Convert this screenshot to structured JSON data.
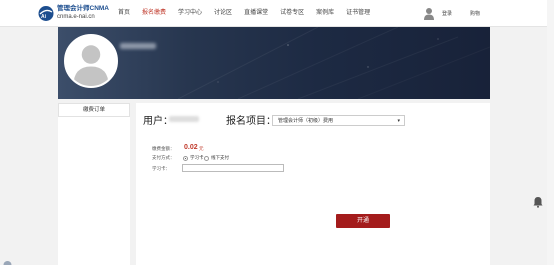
{
  "header": {
    "brand_name": "管理会计师CNMA",
    "brand_url": "cnma.e-nai.cn",
    "nav": [
      {
        "label": "首页",
        "active": false
      },
      {
        "label": "报名缴费",
        "active": true
      },
      {
        "label": "学习中心",
        "active": false
      },
      {
        "label": "讨论区",
        "active": false
      },
      {
        "label": "直播课堂",
        "active": false
      },
      {
        "label": "试卷专区",
        "active": false
      },
      {
        "label": "案例库",
        "active": false
      },
      {
        "label": "证书管理",
        "active": false
      }
    ],
    "login_label": "登录",
    "cart_label": "购物"
  },
  "sidebar": {
    "items": [
      {
        "label": "缴费订单"
      }
    ]
  },
  "form": {
    "user_label": "用户：",
    "project_label": "报名项目：",
    "project_selected": "管理会计师（初级）费用",
    "amount_label": "缴费金额：",
    "amount_value": "0.02",
    "amount_unit": "元",
    "method_label": "支付方式：",
    "methods": [
      {
        "label": "学习卡",
        "checked": true
      },
      {
        "label": "线下支付",
        "checked": false
      }
    ],
    "card_label": "学习卡：",
    "card_value": "",
    "submit_label": "开通"
  },
  "colors": {
    "accent": "#c0392b",
    "button": "#a41c1c",
    "brand": "#1d4e8f",
    "banner": "#27364f"
  }
}
